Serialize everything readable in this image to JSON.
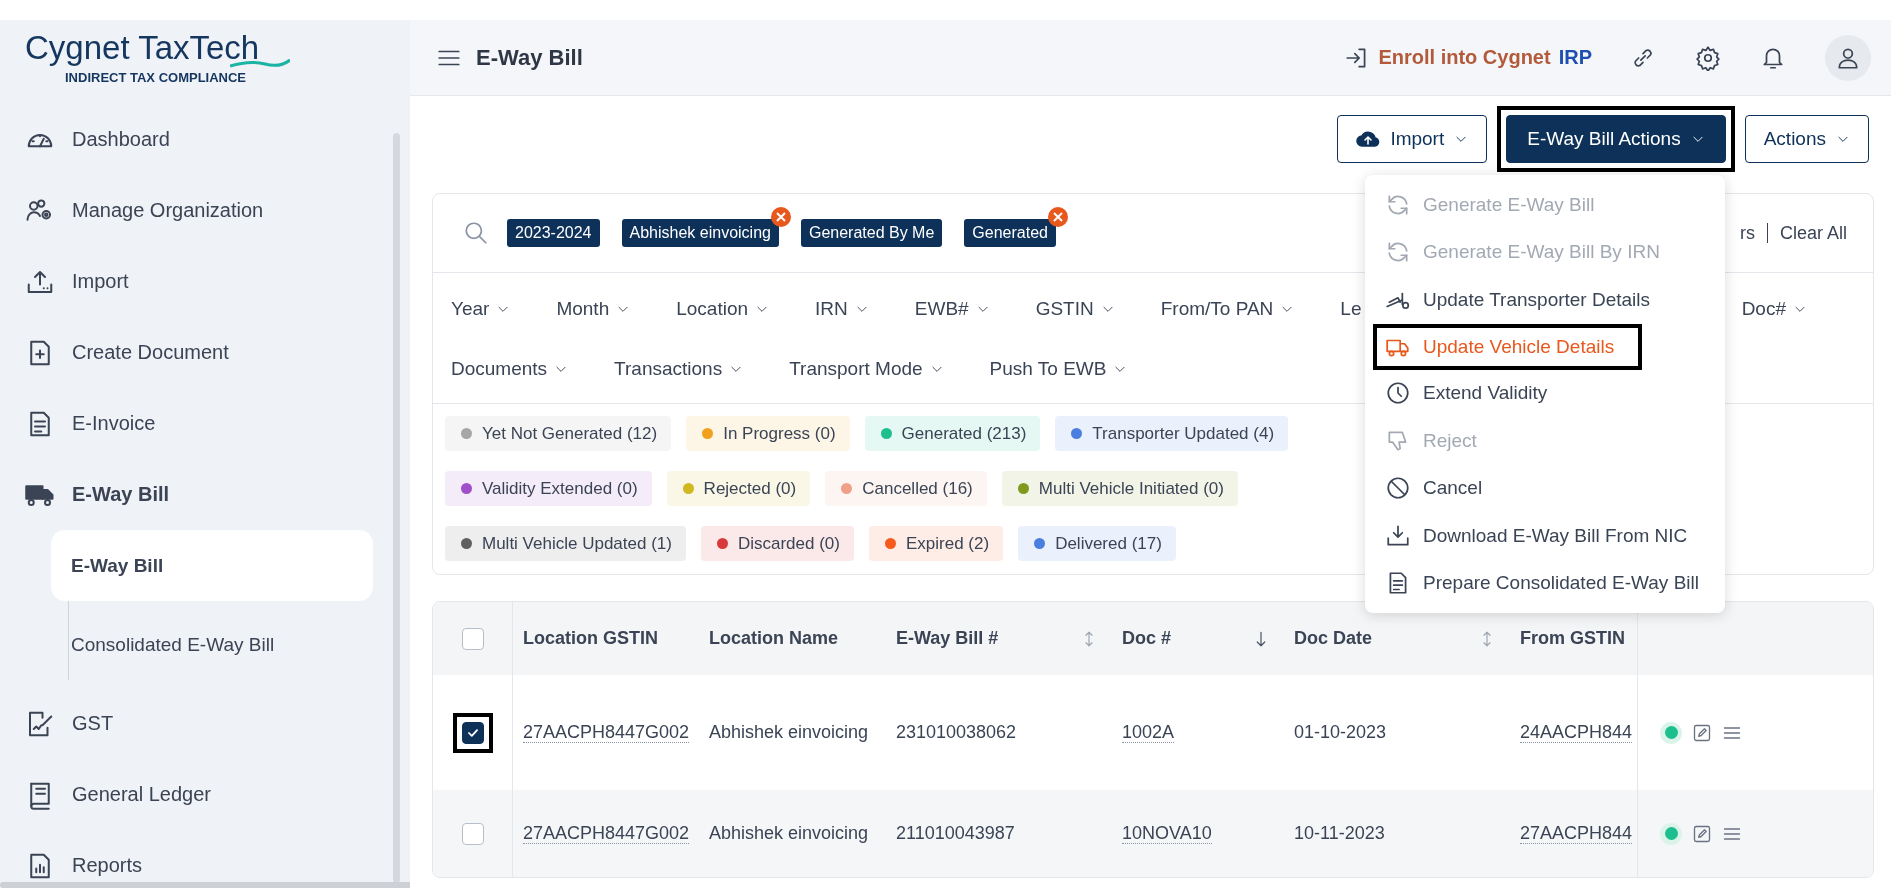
{
  "brand": {
    "wordmark": "**Cygnet** TaxTech",
    "tagline": "INDIRECT TAX COMPLIANCE"
  },
  "sidebar": {
    "items": [
      {
        "label": "Dashboard",
        "kind": "gauge",
        "expanded": false
      },
      {
        "label": "Manage Organization",
        "kind": "team",
        "expanded": false
      },
      {
        "label": "Import",
        "kind": "upload",
        "expanded": false
      },
      {
        "label": "Create Document",
        "kind": "docplus",
        "expanded": false
      },
      {
        "label": "E-Invoice",
        "kind": "doc",
        "expanded": false
      },
      {
        "label": "E-Way Bill",
        "kind": "truck",
        "expanded": true,
        "children": [
          {
            "label": "E-Way Bill",
            "selected": true
          },
          {
            "label": "Consolidated E-Way Bill",
            "selected": false
          }
        ]
      },
      {
        "label": "GST",
        "kind": "signed",
        "expanded": false
      },
      {
        "label": "General Ledger",
        "kind": "book",
        "expanded": false
      },
      {
        "label": "Reports",
        "kind": "report",
        "expanded": false
      }
    ]
  },
  "header": {
    "title": "E-Way Bill",
    "enroll": {
      "text": "Enroll into Cygnet",
      "accent": "IRP"
    }
  },
  "toolbar": {
    "buttons": [
      {
        "label": "Import",
        "kind": "outline",
        "highlighted": false
      },
      {
        "label": "E-Way Bill Actions",
        "kind": "primary",
        "highlighted": true
      },
      {
        "label": "Actions",
        "kind": "outline",
        "highlighted": false
      }
    ]
  },
  "filters": {
    "tags": [
      {
        "label": "2023-2024",
        "removable": false
      },
      {
        "label": "Abhishek einvoicing",
        "removable": true
      },
      {
        "label": "Generated By Me",
        "removable": false
      },
      {
        "label": "Generated",
        "removable": true
      }
    ],
    "trailing_text": "rs",
    "clear": "Clear All",
    "dropdown_rows": [
      [
        {
          "label": "Year",
          "cut": false
        },
        {
          "label": "Month",
          "cut": false
        },
        {
          "label": "Location",
          "cut": false
        },
        {
          "label": "IRN",
          "cut": false
        },
        {
          "label": "EWB#",
          "cut": false
        },
        {
          "label": "GSTIN",
          "cut": false
        },
        {
          "label": "From/To PAN",
          "cut": false
        },
        {
          "label": "Le",
          "cut": true
        },
        {
          "label": "Doc#",
          "cut": false
        }
      ],
      [
        {
          "label": "Documents",
          "cut": false
        },
        {
          "label": "Transactions",
          "cut": false
        },
        {
          "label": "Transport Mode",
          "cut": false
        },
        {
          "label": "Push To EWB",
          "cut": false
        }
      ]
    ],
    "status_rows": [
      [
        {
          "label": "Yet Not Generated (12)",
          "color": "#a6a6a6"
        },
        {
          "label": "In Progress (0)",
          "color": "#f0a01c"
        },
        {
          "label": "Generated (213)",
          "color": "#1dbf8e"
        },
        {
          "label": "Transporter Updated (4)",
          "color": "#4a7fe0"
        }
      ],
      [
        {
          "label": "Validity Extended (0)",
          "color": "#a050c8"
        },
        {
          "label": "Rejected (0)",
          "color": "#d0b820"
        },
        {
          "label": "Cancelled (16)",
          "color": "#f0a088"
        },
        {
          "label": "Multi Vehicle Initiated (0)",
          "color": "#809a20"
        }
      ],
      [
        {
          "label": "Multi Vehicle Updated (1)",
          "color": "#606060"
        },
        {
          "label": "Discarded (0)",
          "color": "#d83a3a"
        },
        {
          "label": "Expired (2)",
          "color": "#f85a1e"
        },
        {
          "label": "Delivered (17)",
          "color": "#4a7fe0"
        }
      ]
    ]
  },
  "table": {
    "all_checked": false,
    "columns": [
      {
        "label": "Location GSTIN",
        "link": true,
        "sortable": false
      },
      {
        "label": "Location Name",
        "link": false,
        "sortable": false
      },
      {
        "label": "E-Way Bill #",
        "link": false,
        "sortable": true,
        "sort_desc": false
      },
      {
        "label": "Doc #",
        "link": true,
        "sortable": true,
        "sort_desc": true
      },
      {
        "label": "Doc Date",
        "link": false,
        "sortable": true,
        "sort_desc": false
      },
      {
        "label": "From GSTIN",
        "link": true,
        "sortable": false
      }
    ],
    "rows": [
      {
        "selected": true,
        "highlighted": true,
        "status_dot": {
          "color": "#1dbf8e"
        },
        "cells": [
          "27AACPH8447G002",
          "Abhishek einvoicing",
          "231010038062",
          "1002A",
          "01-10-2023",
          "24AACPH844"
        ]
      },
      {
        "selected": false,
        "highlighted": false,
        "status_dot": {
          "color": "#1dbf8e"
        },
        "cells": [
          "27AACPH8447G002",
          "Abhishek einvoicing",
          "211010043987",
          "10NOVA10",
          "10-11-2023",
          "27AACPH844"
        ]
      }
    ]
  },
  "menu": {
    "items": [
      {
        "label": "Generate E-Way Bill",
        "kind": "refresh",
        "disabled": true,
        "selected": false,
        "highlighted": false
      },
      {
        "label": "Generate E-Way Bill By IRN",
        "kind": "refresh",
        "disabled": true,
        "selected": false,
        "highlighted": false
      },
      {
        "label": "Update Transporter Details",
        "kind": "ramp",
        "disabled": false,
        "selected": false,
        "highlighted": false
      },
      {
        "label": "Update Vehicle Details",
        "kind": "truck",
        "disabled": false,
        "selected": true,
        "highlighted": true
      },
      {
        "label": "Extend Validity",
        "kind": "clock",
        "disabled": false,
        "selected": false,
        "highlighted": false
      },
      {
        "label": "Reject",
        "kind": "thumbdown",
        "disabled": true,
        "selected": false,
        "highlighted": false
      },
      {
        "label": "Cancel",
        "kind": "ban",
        "disabled": false,
        "selected": false,
        "highlighted": false
      },
      {
        "label": "Download E-Way Bill From NIC",
        "kind": "download",
        "disabled": false,
        "selected": false,
        "highlighted": false
      },
      {
        "label": "Prepare Consolidated E-Way Bill",
        "kind": "doc",
        "disabled": false,
        "selected": false,
        "highlighted": false
      }
    ]
  }
}
